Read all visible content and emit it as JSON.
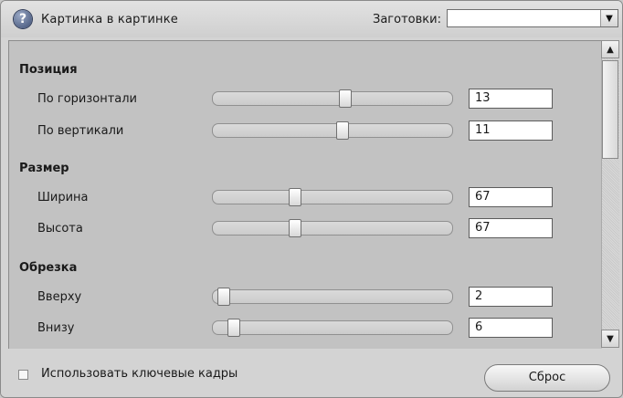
{
  "header": {
    "help_icon_glyph": "?",
    "title": "Картинка в картинке",
    "presets_label": "Заготовки:",
    "presets_value": "",
    "dropdown_glyph": "▼"
  },
  "sections": [
    {
      "title": "Позиция",
      "rows": [
        {
          "label": "По горизонтали",
          "value": "13"
        },
        {
          "label": "По вертикали",
          "value": "11"
        }
      ]
    },
    {
      "title": "Размер",
      "rows": [
        {
          "label": "Ширина",
          "value": "67"
        },
        {
          "label": "Высота",
          "value": "67"
        }
      ]
    },
    {
      "title": "Обрезка",
      "rows": [
        {
          "label": "Вверху",
          "value": "2"
        },
        {
          "label": "Внизу",
          "value": "6"
        }
      ]
    }
  ],
  "scrollbar": {
    "up_glyph": "▲",
    "down_glyph": "▼"
  },
  "footer": {
    "use_keyframes_label": "Использовать ключевые кадры",
    "use_keyframes_checked": false,
    "reset_label": "Сброс"
  }
}
